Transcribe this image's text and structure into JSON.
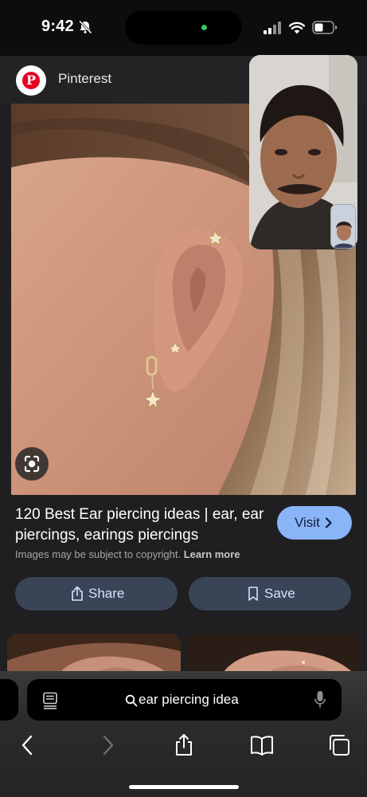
{
  "status_bar": {
    "time": "9:42"
  },
  "source": {
    "name": "Pinterest",
    "logo_letter": "P"
  },
  "result": {
    "title": "120 Best Ear piercing ideas | ear, ear piercings, earings piercings",
    "visit_label": "Visit",
    "copyright_text": "Images may be subject to copyright.",
    "learn_more": "Learn more"
  },
  "actions": {
    "share_label": "Share",
    "save_label": "Save"
  },
  "safari": {
    "address_text": "ear piercing idea"
  },
  "colors": {
    "visit_bg": "#8ab4f8",
    "action_bg": "#394457",
    "pinterest_red": "#e60023",
    "facetime_green": "#34c759"
  },
  "icons": [
    "bell-slash-icon",
    "cellular-icon",
    "wifi-icon",
    "battery-icon",
    "lens-icon",
    "chevron-right-icon",
    "share-icon",
    "bookmark-icon",
    "reader-icon",
    "search-icon",
    "mic-icon",
    "back-icon",
    "forward-icon",
    "bookmarks-icon",
    "tabs-icon"
  ]
}
